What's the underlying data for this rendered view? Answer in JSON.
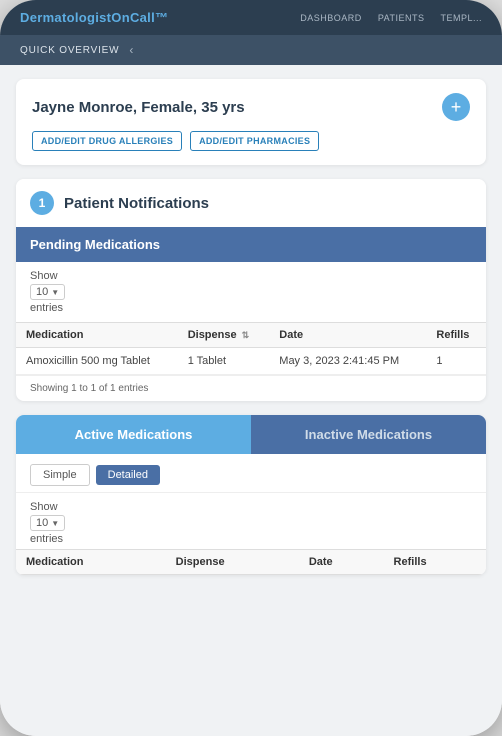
{
  "nav": {
    "logo_text": "DermatologistOnCall",
    "logo_trademark": "™",
    "links": [
      "DASHBOARD",
      "PATIENTS",
      "TEMPL..."
    ]
  },
  "subnav": {
    "label": "QUICK OVERVIEW",
    "icon": "chevron-left"
  },
  "patient": {
    "name": "Jayne Monroe, Female, 35 yrs",
    "add_icon": "+",
    "btn_allergies": "ADD/EDIT DRUG ALLERGIES",
    "btn_pharmacies": "ADD/EDIT PHARMACIES"
  },
  "section1": {
    "number": "1",
    "title": "Patient Notifications"
  },
  "pending_medications": {
    "header": "Pending Medications",
    "show_label": "Show",
    "show_value": "10",
    "entries_label": "entries",
    "columns": [
      "Medication",
      "Dispense",
      "Date",
      "Refills"
    ],
    "rows": [
      {
        "medication": "Amoxicillin 500 mg Tablet",
        "dispense": "1 Tablet",
        "date": "May 3, 2023 2:41:45 PM",
        "refills": "1"
      }
    ],
    "showing_text": "Showing 1 to 1 of 1 entries"
  },
  "medications": {
    "tab_active": "Active Medications",
    "tab_inactive": "Inactive Medications",
    "view_simple": "Simple",
    "view_detailed": "Detailed",
    "show_label": "Show",
    "show_value": "10",
    "entries_label": "entries",
    "columns": [
      "Medication",
      "Dispense",
      "Date",
      "Refills"
    ]
  }
}
